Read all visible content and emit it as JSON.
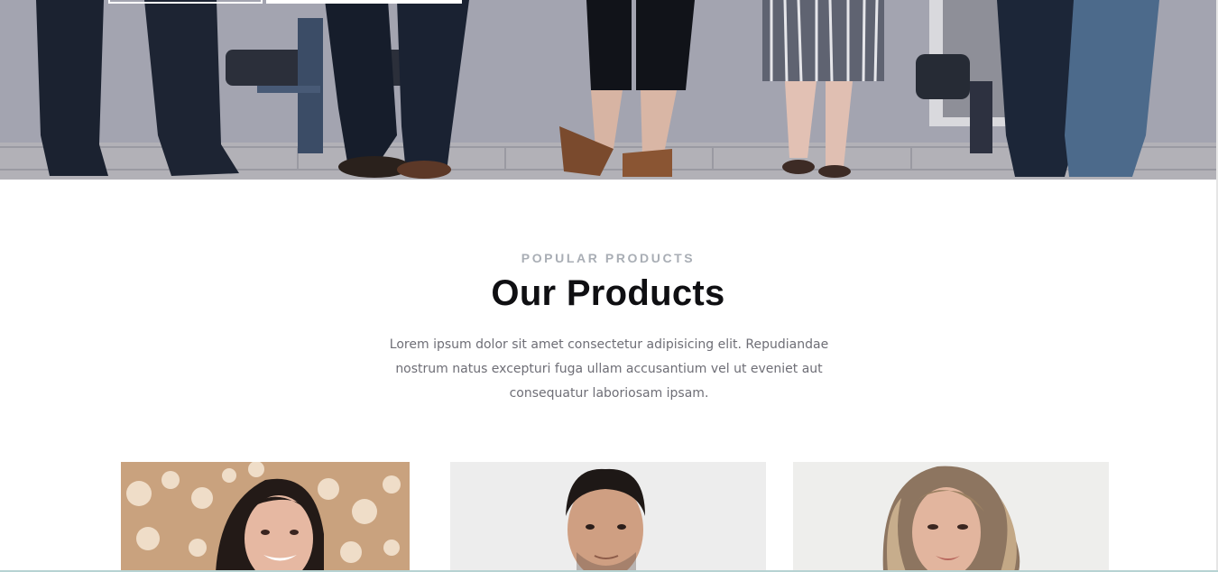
{
  "hero": {
    "image_alt": "group of people standing near chairs"
  },
  "section": {
    "eyebrow": "POPULAR PRODUCTS",
    "title": "Our Products",
    "description": "Lorem ipsum dolor sit amet consectetur adipisicing elit. Repudiandae nostrum natus excepturi fuga ullam accusantium vel ut eveniet aut consequatur laboriosam ipsam."
  },
  "products": [
    {
      "image_alt": "smiling woman with dark hair"
    },
    {
      "image_alt": "man with short dark hair"
    },
    {
      "image_alt": "woman with wavy blonde hair"
    }
  ],
  "colors": {
    "eyebrow": "#a9aeb5",
    "title": "#0f0f12",
    "description": "#6e6e76"
  }
}
